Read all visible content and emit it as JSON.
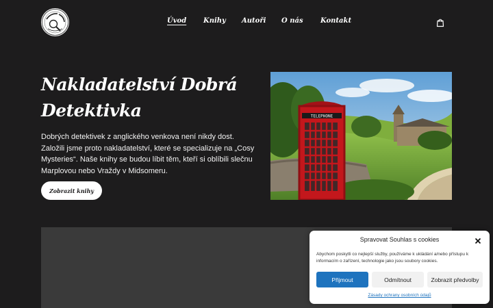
{
  "header": {
    "logo_alt": "Dobrá Detektivka",
    "nav": [
      {
        "label": "Úvod",
        "active": true
      },
      {
        "label": "Knihy",
        "active": false
      },
      {
        "label": "Autoři",
        "active": false
      },
      {
        "label": "O nás",
        "active": false
      },
      {
        "label": "Kontakt",
        "active": false
      }
    ],
    "cart_icon": "shopping-bag-icon"
  },
  "hero": {
    "title": "Nakladatelství Dobrá Detektivka",
    "text": "Dobrých detektivek z anglického venkova není nikdy dost. Založili jsme proto nakladatelství, které se specializuje na „Cosy Mysteries“. Naše knihy se budou líbit těm, kteří si oblíbili slečnu Marplovou nebo Vraždy v Midsomeru.",
    "button_label": "Zobrazit knihy",
    "image_sign": "TELEPHONE"
  },
  "cookie_banner": {
    "title": "Spravovat Souhlas s cookies",
    "text": "Abychom poskytli co nejlepší služby, používáme k ukládání a/nebo přístupu k informacím o zařízení, technologie jako jsou soubory cookies.",
    "accept_label": "Přijmout",
    "deny_label": "Odmítnout",
    "preferences_label": "Zobrazit předvolby",
    "policy_link": "Zásady ochrany osobních údajů"
  },
  "colors": {
    "background": "#1d1c1d",
    "panel": "#3a3a3a",
    "accent": "#1e73be",
    "booth_red": "#c3171c"
  }
}
